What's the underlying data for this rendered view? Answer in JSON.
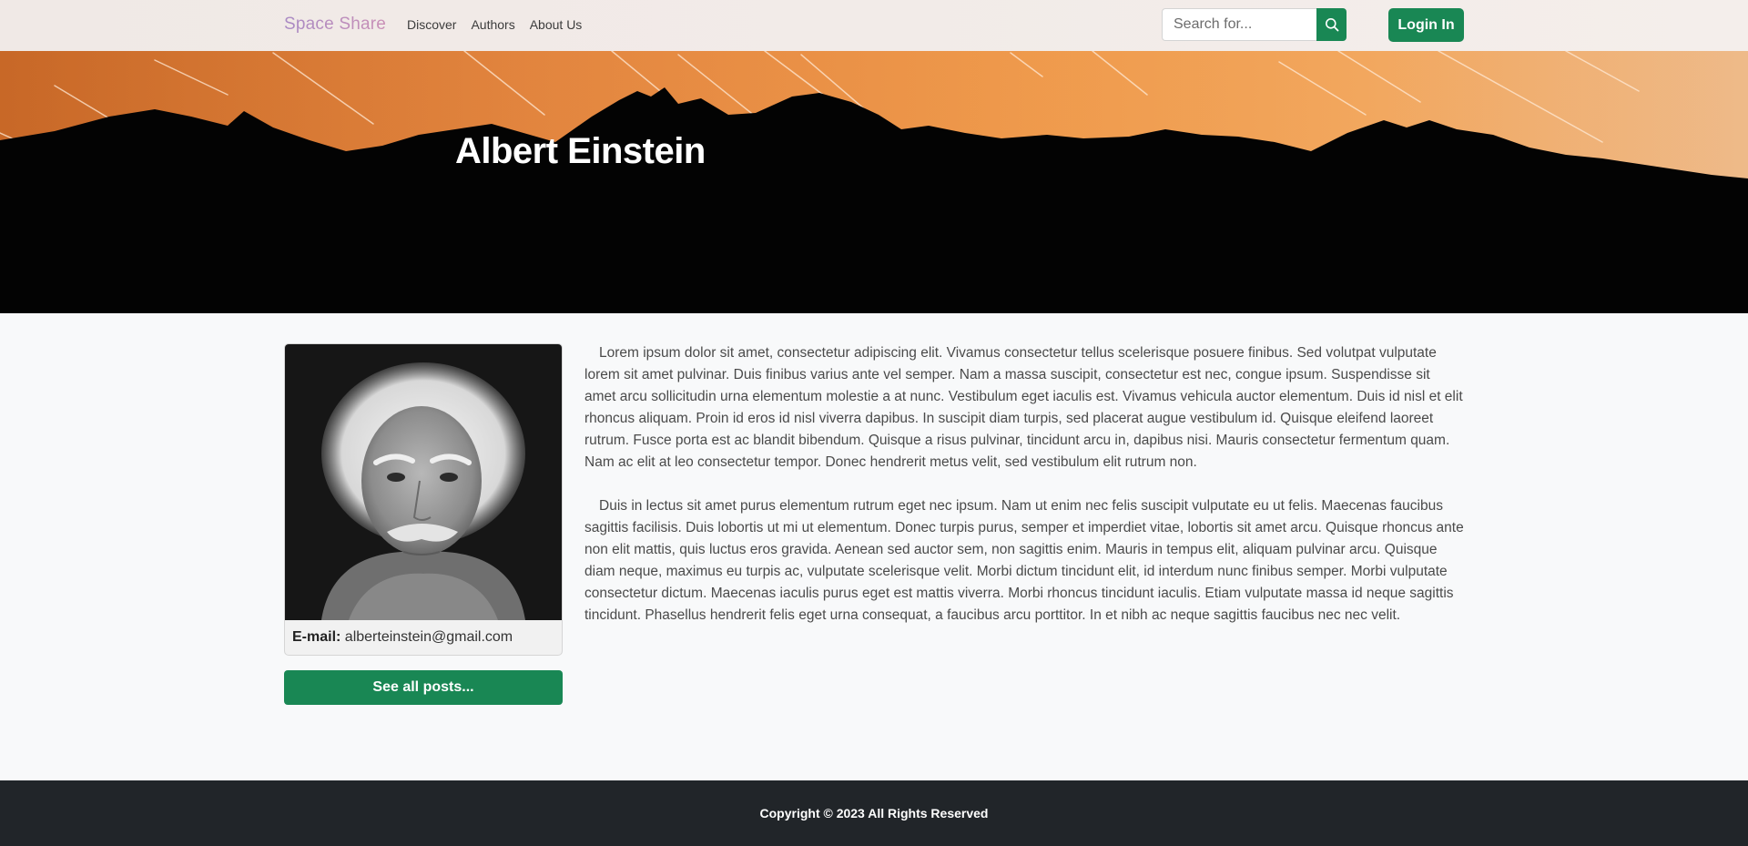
{
  "navbar": {
    "brand": "Space Share",
    "links": [
      "Discover",
      "Authors",
      "About Us"
    ],
    "search_placeholder": "Search for...",
    "search_icon": "search-icon",
    "login_label": "Login In"
  },
  "hero": {
    "title": "Albert Einstein"
  },
  "profile": {
    "email_label": "E-mail:",
    "email": "alberteinstein@gmail.com",
    "see_all_label": "See all posts..."
  },
  "bio": {
    "paragraphs": [
      "Lorem ipsum dolor sit amet, consectetur adipiscing elit. Vivamus consectetur tellus scelerisque posuere finibus. Sed volutpat vulputate lorem sit amet pulvinar. Duis finibus varius ante vel semper. Nam a massa suscipit, consectetur est nec, congue ipsum. Suspendisse sit amet arcu sollicitudin urna elementum molestie a at nunc. Vestibulum eget iaculis est. Vivamus vehicula auctor elementum. Duis id nisl et elit rhoncus aliquam. Proin id eros id nisl viverra dapibus. In suscipit diam turpis, sed placerat augue vestibulum id. Quisque eleifend laoreet rutrum. Fusce porta est ac blandit bibendum. Quisque a risus pulvinar, tincidunt arcu in, dapibus nisi. Mauris consectetur fermentum quam. Nam ac elit at leo consectetur tempor. Donec hendrerit metus velit, sed vestibulum elit rutrum non.",
      "Duis in lectus sit amet purus elementum rutrum eget nec ipsum. Nam ut enim nec felis suscipit vulputate eu ut felis. Maecenas faucibus sagittis facilisis. Duis lobortis ut mi ut elementum. Donec turpis purus, semper et imperdiet vitae, lobortis sit amet arcu. Quisque rhoncus ante non elit mattis, quis luctus eros gravida. Aenean sed auctor sem, non sagittis enim. Mauris in tempus elit, aliquam pulvinar arcu. Quisque diam neque, maximus eu turpis ac, vulputate scelerisque velit. Morbi dictum tincidunt elit, id interdum nunc finibus semper. Morbi vulputate consectetur dictum. Maecenas iaculis purus eget est mattis viverra. Morbi rhoncus tincidunt iaculis. Etiam vulputate massa id neque sagittis tincidunt. Phasellus hendrerit felis eget urna consequat, a faucibus arcu porttitor. In et nibh ac neque sagittis faucibus nec nec velit."
    ]
  },
  "footer": {
    "copyright": "Copyright © 2023 All Rights Reserved"
  },
  "colors": {
    "accent": "#198754",
    "footer_bg": "#212529",
    "page_bg": "#f8f9fa"
  }
}
